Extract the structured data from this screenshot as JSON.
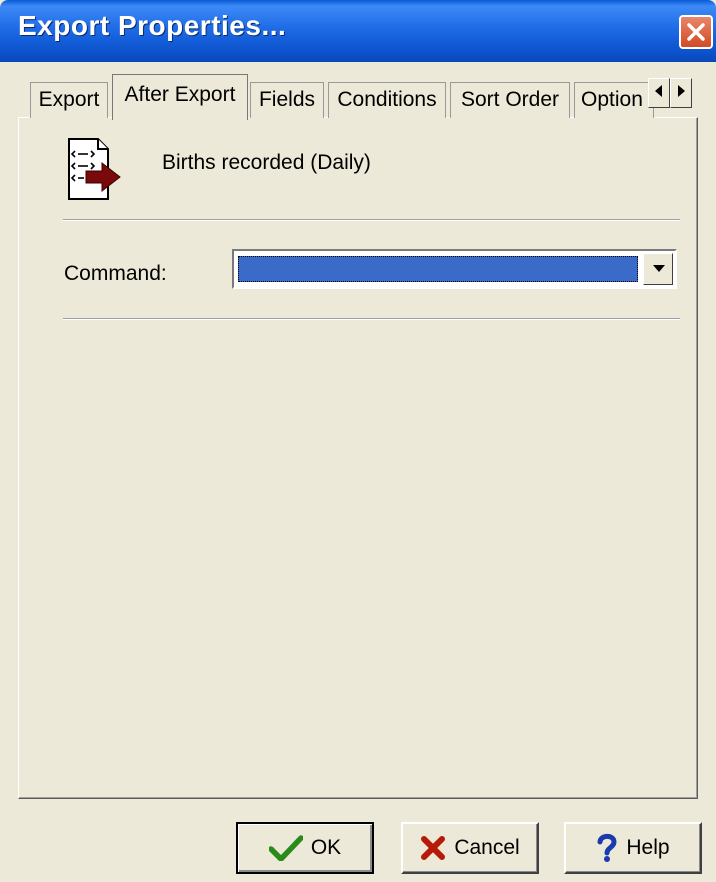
{
  "window": {
    "title": "Export Properties..."
  },
  "tabs": [
    {
      "label": "Export"
    },
    {
      "label": "After Export"
    },
    {
      "label": "Fields"
    },
    {
      "label": "Conditions"
    },
    {
      "label": "Sort Order"
    },
    {
      "label": "Option"
    }
  ],
  "export_name": "Births recorded (Daily)",
  "command": {
    "label": "Command:",
    "value": ""
  },
  "buttons": {
    "ok": "OK",
    "cancel": "Cancel",
    "help": "Help"
  },
  "colors": {
    "titlebar": "#0a5bd6",
    "selection": "#3a6bc8",
    "ok_check": "#2a8a1a",
    "cancel_x": "#b81a0a",
    "help_q": "#1a3ab0",
    "icon_arrow": "#7a0a0a"
  },
  "icons": [
    "close-icon",
    "export-doc-icon",
    "check-icon",
    "cross-icon",
    "question-icon",
    "left-arrow-icon",
    "right-arrow-icon",
    "dropdown-arrow-icon"
  ]
}
